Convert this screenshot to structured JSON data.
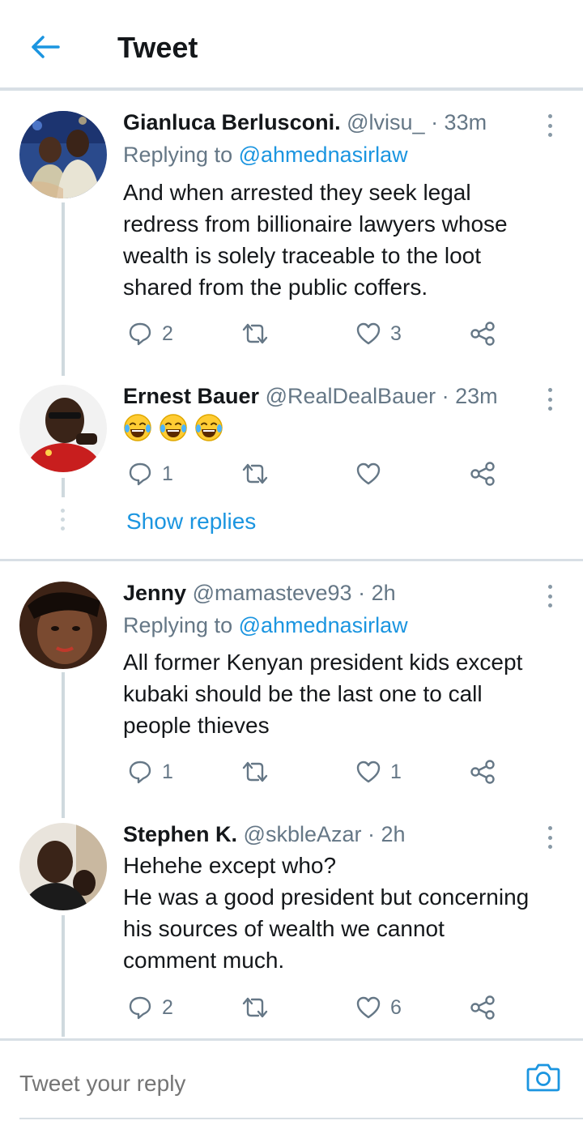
{
  "header": {
    "title": "Tweet"
  },
  "tweets": [
    {
      "name": "Gianluca Berlusconi.",
      "handle": "@lvisu_",
      "time": "· 33m",
      "replying_prefix": "Replying to",
      "replying_to": "@ahmednasirlaw",
      "text": "And when arrested they seek legal\nredress from billionaire lawyers whose\nwealth is solely traceable to the loot\nshared from the public coffers.",
      "replies": "2",
      "retweets": "",
      "likes": "3"
    },
    {
      "name": "Ernest Bauer",
      "handle": "@RealDealBauer",
      "time": "· 23m",
      "emojis": [
        "face-with-tears-of-joy",
        "face-with-tears-of-joy",
        "face-with-tears-of-joy"
      ],
      "replies": "1",
      "retweets": "",
      "likes": ""
    },
    {
      "name": "Jenny",
      "handle": "@mamasteve93",
      "time": "· 2h",
      "replying_prefix": "Replying to",
      "replying_to": "@ahmednasirlaw",
      "text": "All former Kenyan president kids except\nkubaki should be the last one to call\npeople thieves",
      "replies": "1",
      "retweets": "",
      "likes": "1"
    },
    {
      "name": "Stephen K.",
      "handle": "@skbleAzar",
      "time": "· 2h",
      "text": "Hehehe except who?\nHe was a good president but concerning\nhis sources of wealth we cannot\ncomment much.",
      "replies": "2",
      "retweets": "",
      "likes": "6"
    }
  ],
  "show_replies": "Show replies",
  "reply_box": {
    "placeholder": "Tweet your reply"
  },
  "colors": {
    "accent": "#1b95e0",
    "text": "#14171a",
    "secondary": "#657786",
    "divider": "#d8dfe5"
  },
  "icons": [
    "back-arrow-icon",
    "reply-icon",
    "retweet-icon",
    "like-icon",
    "share-icon",
    "more-vertical-icon",
    "camera-icon"
  ]
}
